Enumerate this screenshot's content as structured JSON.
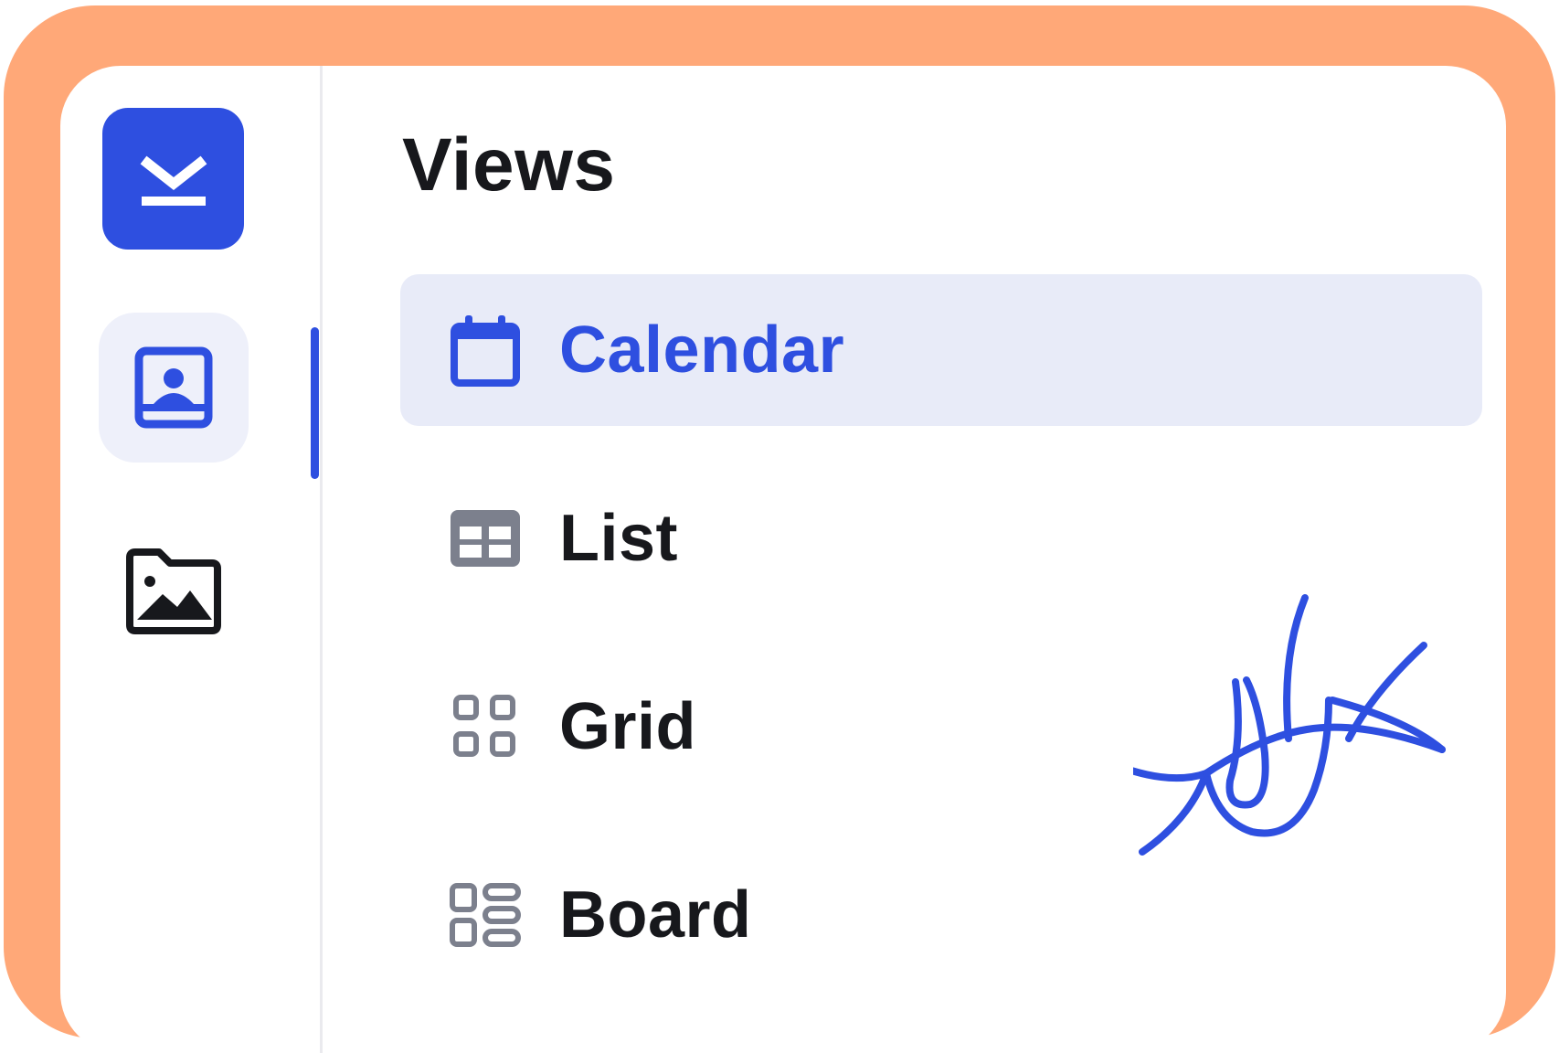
{
  "colors": {
    "frame": "#FFA878",
    "accent": "#2E4FE0",
    "active_bg": "#E8EBF8",
    "icon_gray": "#7C808D",
    "text": "#17181C"
  },
  "rail": {
    "logo_icon": "download-tray-logo",
    "items": [
      {
        "icon": "contact-card-icon",
        "active": true
      },
      {
        "icon": "image-folder-icon",
        "active": false
      }
    ]
  },
  "views": {
    "title": "Views",
    "items": [
      {
        "label": "Calendar",
        "icon": "calendar-icon",
        "active": true
      },
      {
        "label": "List",
        "icon": "table-icon",
        "active": false
      },
      {
        "label": "Grid",
        "icon": "grid-icon",
        "active": false
      },
      {
        "label": "Board",
        "icon": "board-icon",
        "active": false
      }
    ]
  },
  "decoration": {
    "icon": "eye-doodle-icon"
  }
}
